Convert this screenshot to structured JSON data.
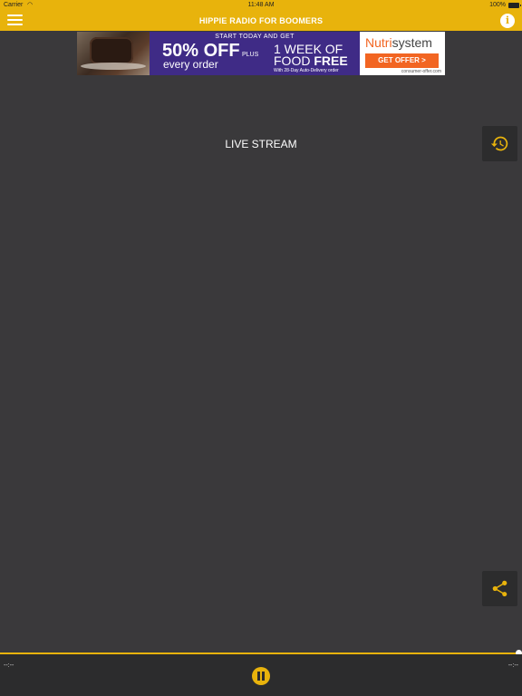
{
  "status_bar": {
    "carrier": "Carrier",
    "time": "11:48 AM",
    "battery": "100%"
  },
  "header": {
    "title": "HIPPIE RADIO FOR BOOMERS"
  },
  "ad": {
    "start_text": "START TODAY AND GET",
    "discount": "50% OFF",
    "every_order": "every order",
    "plus": "PLUS",
    "week_line": "1 WEEK OF",
    "food_line": "FOOD",
    "free": "FREE",
    "auto_delivery": "With 28-Day Auto-Delivery order",
    "brand_prefix": "Nutri",
    "brand_suffix": "system",
    "cta": "GET OFFER >",
    "domain": "consumer-offer.com"
  },
  "main": {
    "stream_label": "LIVE STREAM"
  },
  "player": {
    "elapsed": "--:--",
    "remaining": "--:--",
    "progress": 1.0
  },
  "icons": {
    "menu": "hamburger-icon",
    "info": "info-icon",
    "history": "history-icon",
    "share": "share-icon",
    "pause": "pause-icon"
  },
  "colors": {
    "accent": "#e8b30c",
    "background": "#3a393b",
    "panel": "#2c2c2d"
  }
}
